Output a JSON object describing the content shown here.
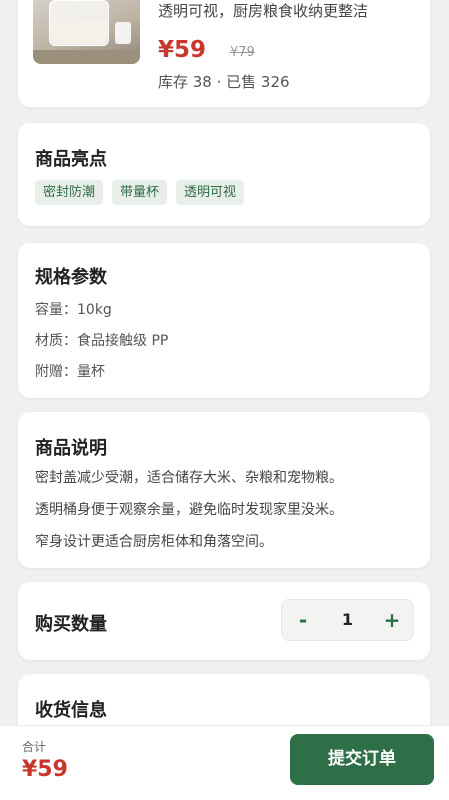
{
  "product": {
    "description": "透明可视，厨房粮食收纳更整洁",
    "price": "¥59",
    "original_price": "¥79",
    "stock_sales": "库存 38 · 已售 326"
  },
  "highlights": {
    "title": "商品亮点",
    "tags": [
      "密封防潮",
      "带量杯",
      "透明可视"
    ]
  },
  "specs": {
    "title": "规格参数",
    "items": [
      "容量：10kg",
      "材质：食品接触级 PP",
      "附赠：量杯"
    ]
  },
  "description": {
    "title": "商品说明",
    "lines": [
      "密封盖减少受潮，适合储存大米、杂粮和宠物粮。",
      "透明桶身便于观察余量，避免临时发现家里没米。",
      "窄身设计更适合厨房柜体和角落空间。"
    ]
  },
  "quantity": {
    "title": "购买数量",
    "minus": "-",
    "value": "1",
    "plus": "+"
  },
  "address": {
    "title": "收货信息"
  },
  "bottom_bar": {
    "total_label": "合计",
    "total_value": "¥59",
    "submit_label": "提交订单"
  },
  "colors": {
    "accent": "#2e6f47",
    "price": "#c8372e",
    "tag_bg": "#e8efe8",
    "background": "#eff1ee"
  }
}
